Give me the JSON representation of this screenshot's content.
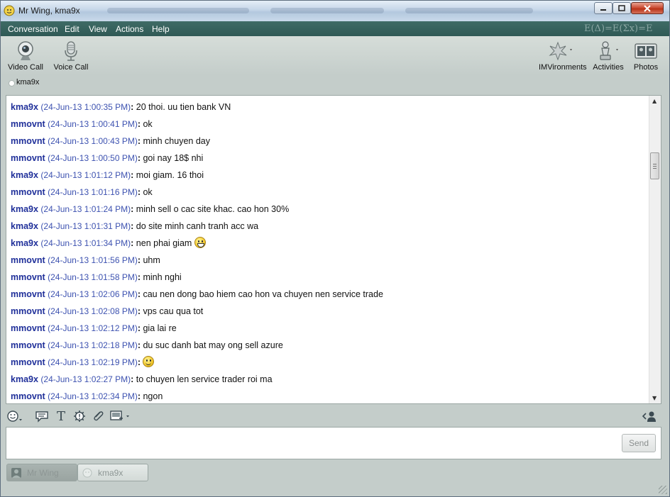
{
  "window": {
    "title": "Mr Wing, kma9x",
    "controls": {
      "minimize": "–",
      "maximize": "□",
      "close": "✕"
    }
  },
  "menu": {
    "items": [
      "Conversation",
      "Edit",
      "View",
      "Actions",
      "Help"
    ],
    "decoration": "E(Δ)=E(Σx)=E"
  },
  "toolbar": {
    "left": [
      {
        "label": "Video Call",
        "icon": "webcam-icon"
      },
      {
        "label": "Voice Call",
        "icon": "microphone-icon"
      }
    ],
    "right": [
      {
        "label": "IMVironments",
        "icon": "imvironments-icon"
      },
      {
        "label": "Activities",
        "icon": "activities-icon"
      },
      {
        "label": "Photos",
        "icon": "photos-icon"
      }
    ]
  },
  "contact": {
    "name": "kma9x",
    "status": "offline"
  },
  "messages": [
    {
      "sender": "kma9x",
      "time": "(24-Jun-13 1:00:35 PM)",
      "text": "20 thoi. uu tien bank VN"
    },
    {
      "sender": "mmovnt",
      "time": "(24-Jun-13 1:00:41 PM)",
      "text": "ok"
    },
    {
      "sender": "mmovnt",
      "time": "(24-Jun-13 1:00:43 PM)",
      "text": "minh chuyen day"
    },
    {
      "sender": "mmovnt",
      "time": "(24-Jun-13 1:00:50 PM)",
      "text": "goi nay 18$ nhi"
    },
    {
      "sender": "kma9x",
      "time": "(24-Jun-13 1:01:12 PM)",
      "text": "moi giam. 16 thoi"
    },
    {
      "sender": "mmovnt",
      "time": "(24-Jun-13 1:01:16 PM)",
      "text": "ok"
    },
    {
      "sender": "kma9x",
      "time": "(24-Jun-13 1:01:24 PM)",
      "text": "minh sell o cac site khac. cao hon 30%"
    },
    {
      "sender": "kma9x",
      "time": "(24-Jun-13 1:01:31 PM)",
      "text": "do site minh canh tranh acc wa"
    },
    {
      "sender": "kma9x",
      "time": "(24-Jun-13 1:01:34 PM)",
      "text": "nen phai giam",
      "emoticon": "grin"
    },
    {
      "sender": "mmovnt",
      "time": "(24-Jun-13 1:01:56 PM)",
      "text": "uhm"
    },
    {
      "sender": "mmovnt",
      "time": "(24-Jun-13 1:01:58 PM)",
      "text": "minh nghi"
    },
    {
      "sender": "mmovnt",
      "time": "(24-Jun-13 1:02:06 PM)",
      "text": "cau nen dong bao hiem cao hon va chuyen nen service trade"
    },
    {
      "sender": "mmovnt",
      "time": "(24-Jun-13 1:02:08 PM)",
      "text": "vps cau qua tot"
    },
    {
      "sender": "mmovnt",
      "time": "(24-Jun-13 1:02:12 PM)",
      "text": "gia lai re"
    },
    {
      "sender": "mmovnt",
      "time": "(24-Jun-13 1:02:18 PM)",
      "text": "du suc danh bat may ong sell azure"
    },
    {
      "sender": "mmovnt",
      "time": "(24-Jun-13 1:02:19 PM)",
      "text": "",
      "emoticon": "smile"
    },
    {
      "sender": "kma9x",
      "time": "(24-Jun-13 1:02:27 PM)",
      "text": "to chuyen len service trader roi ma"
    },
    {
      "sender": "mmovnt",
      "time": "(24-Jun-13 1:02:34 PM)",
      "text": "ngon"
    }
  ],
  "format_bar": {
    "left_icons": [
      "emoticon-menu-icon",
      "nudge-icon",
      "text-format-icon",
      "settings-icon",
      "attach-icon",
      "screenshot-icon"
    ],
    "text_format_glyph": "T",
    "right_icon": "contact-panel-icon"
  },
  "compose": {
    "value": "",
    "send_label": "Send"
  },
  "tabs": [
    {
      "label": "Mr Wing",
      "active": false
    },
    {
      "label": "kma9x",
      "active": true
    }
  ],
  "colors": {
    "menubar": "#2f5955",
    "sender": "#20309a",
    "timestamp": "#3d52b0",
    "chrome": "#c4cdca"
  }
}
